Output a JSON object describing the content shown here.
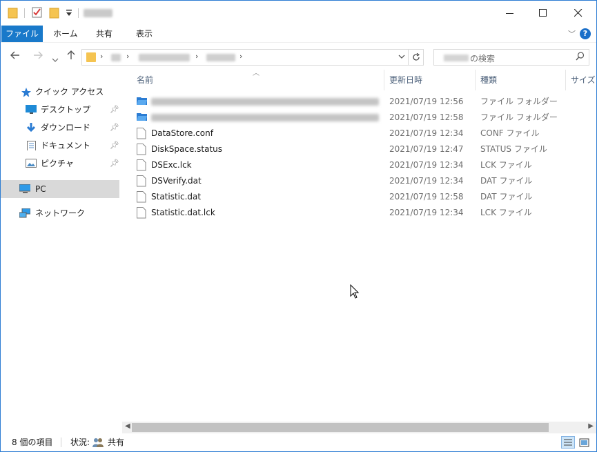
{
  "ribbon": {
    "tabs": [
      "ファイル",
      "ホーム",
      "共有",
      "表示"
    ]
  },
  "search": {
    "placeholder_suffix": "の検索"
  },
  "nav_pane": {
    "quick_access": "クイック アクセス",
    "items": [
      {
        "label": "デスクトップ",
        "icon": "desktop-icon",
        "pinned": true
      },
      {
        "label": "ダウンロード",
        "icon": "download-icon",
        "pinned": true
      },
      {
        "label": "ドキュメント",
        "icon": "document-icon",
        "pinned": true
      },
      {
        "label": "ピクチャ",
        "icon": "picture-icon",
        "pinned": true
      }
    ],
    "pc": "PC",
    "network": "ネットワーク"
  },
  "columns": {
    "name": "名前",
    "date": "更新日時",
    "type": "種類",
    "size": "サイズ"
  },
  "files": [
    {
      "name": "",
      "blurred": true,
      "date": "2021/07/19 12:56",
      "type": "ファイル フォルダー",
      "icon": "folder-icon"
    },
    {
      "name": "",
      "blurred": true,
      "date": "2021/07/19 12:58",
      "type": "ファイル フォルダー",
      "icon": "folder-icon"
    },
    {
      "name": "DataStore.conf",
      "date": "2021/07/19 12:34",
      "type": "CONF ファイル",
      "icon": "file-icon"
    },
    {
      "name": "DiskSpace.status",
      "date": "2021/07/19 12:47",
      "type": "STATUS ファイル",
      "icon": "file-icon"
    },
    {
      "name": "DSExc.lck",
      "date": "2021/07/19 12:34",
      "type": "LCK ファイル",
      "icon": "file-icon"
    },
    {
      "name": "DSVerify.dat",
      "date": "2021/07/19 12:34",
      "type": "DAT ファイル",
      "icon": "file-icon"
    },
    {
      "name": "Statistic.dat",
      "date": "2021/07/19 12:58",
      "type": "DAT ファイル",
      "icon": "file-icon"
    },
    {
      "name": "Statistic.dat.lck",
      "date": "2021/07/19 12:34",
      "type": "LCK ファイル",
      "icon": "file-icon"
    }
  ],
  "status": {
    "count": "8 個の項目",
    "state_label": "状況:",
    "state_value": "共有"
  },
  "colors": {
    "accent": "#1979ca",
    "folder": "#f5c451",
    "selected_bg": "#d9d9d9"
  }
}
